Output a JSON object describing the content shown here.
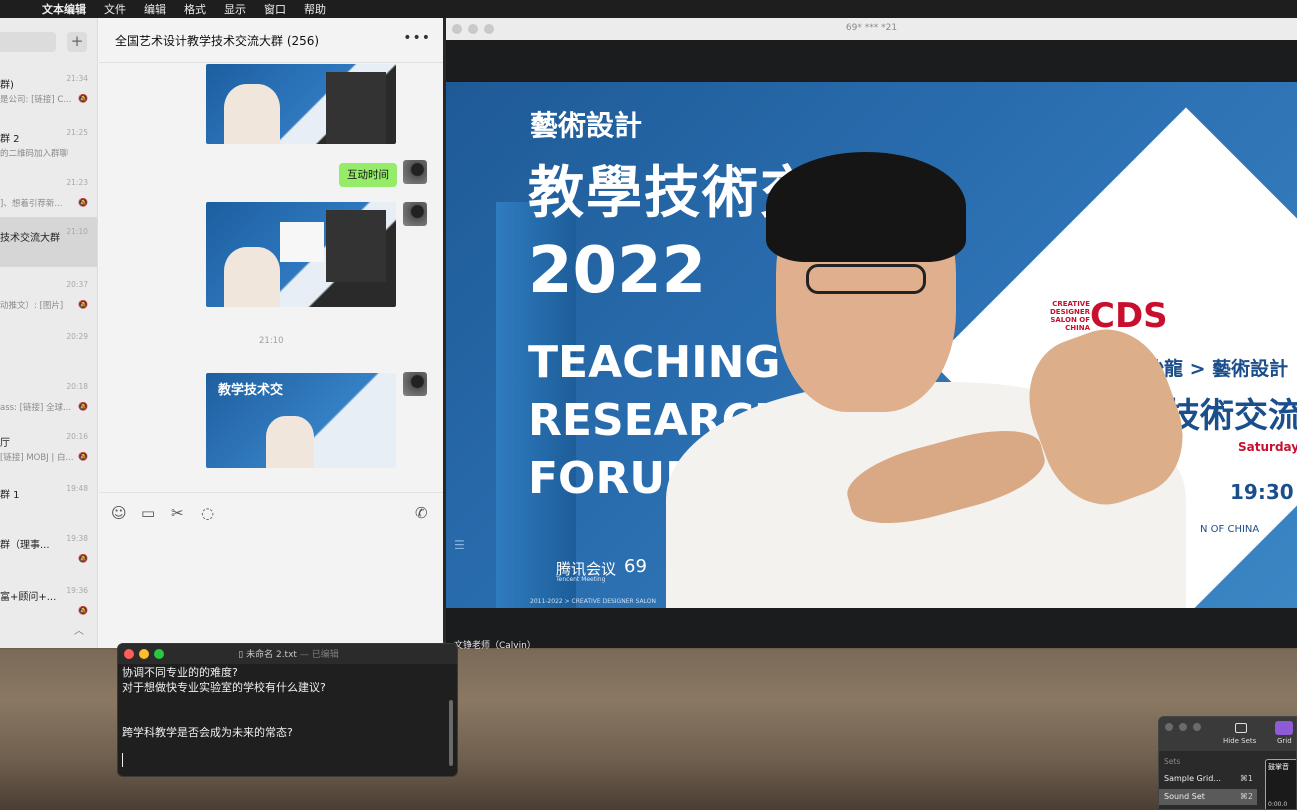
{
  "menubar": {
    "app": "文本编辑",
    "items": [
      "文件",
      "编辑",
      "格式",
      "显示",
      "窗口",
      "帮助"
    ]
  },
  "wechat": {
    "chat_title": "全国艺术设计教学技术交流大群 (256)",
    "conversations": [
      {
        "name": "群)",
        "msg": "是公司: [链接] C...",
        "time": "21:34"
      },
      {
        "name": "群 2",
        "msg": "的二维码加入群聊",
        "time": "21:25"
      },
      {
        "name": "",
        "msg": "]、想着引荐新...",
        "time": "21:23"
      },
      {
        "name": "技术交流大群",
        "msg": "",
        "time": "21:10"
      },
      {
        "name": "",
        "msg": "动推文）: [图片]",
        "time": "20:37"
      },
      {
        "name": "",
        "msg": "",
        "time": "20:29"
      },
      {
        "name": "",
        "msg": "ass: [链接] 全球...",
        "time": "20:18"
      },
      {
        "name": "厅",
        "msg": "[链接] MOBJ | 白...",
        "time": "20:16"
      },
      {
        "name": "群 1",
        "msg": "",
        "time": "19:48"
      },
      {
        "name": "群（理事...",
        "msg": "",
        "time": "19:38"
      },
      {
        "name": "富+顾问+...",
        "msg": "",
        "time": "19:36"
      }
    ],
    "bubble_text": "互动时间",
    "timestamp": "21:10",
    "thumb_text": "教学技术交"
  },
  "meeting": {
    "window_title": "69* *** *21",
    "slide": {
      "small_title": "藝術設計",
      "big_title": "教學技術交流",
      "year": "2022",
      "teaching_line1": "TEACHING",
      "teaching_line2": "RESEARCH",
      "teaching_line3": "FORUM",
      "brand": "腾讯会议",
      "brand_sub": "Tencent Meeting",
      "code": "69",
      "cds_small": "CREATIVE DESIGNER SALON OF CHINA",
      "cds": "CDS",
      "salon": "中国设计师沙龍 > 藝術設計",
      "sub2": "技術交流",
      "saturday": "Saturday",
      "time": "19:30",
      "of_china": "N OF CHINA",
      "footer": "2011-2022 > CREATIVE DESIGNER SALON"
    },
    "speaker_name": "文铮老师（Calvin）"
  },
  "textedit": {
    "title": "未命名 2.txt",
    "edited": "— 已编辑",
    "lines": [
      "协调不同专业的的难度?",
      "对于想做快专业实验室的学校有什么建议?",
      "",
      "跨学科教学是否会成为未来的常态?"
    ]
  },
  "sets_panel": {
    "hide_sets": "Hide Sets",
    "grid": "Grid",
    "header": "Sets",
    "items": [
      {
        "label": "Sample Grid...",
        "key": "⌘1"
      },
      {
        "label": "Sound Set",
        "key": "⌘2"
      }
    ],
    "thumb_title": "鼓掌音",
    "thumb_time": "0:00.0"
  },
  "colors": {
    "wechat_bubble": "#95ec69",
    "cds_red": "#c8102e",
    "slide_blue": "#1e5a96",
    "grid_accent": "#8e5bd6"
  }
}
